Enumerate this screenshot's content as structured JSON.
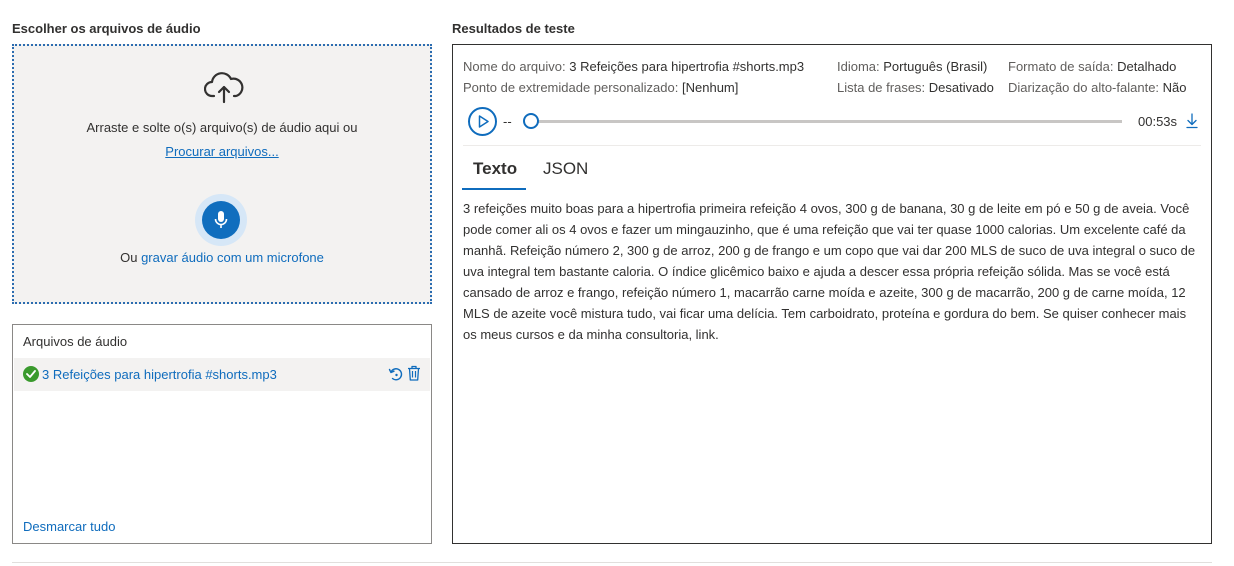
{
  "left": {
    "choose_title": "Escolher os arquivos de áudio",
    "drop_text": "Arraste e solte o(s) arquivo(s) de áudio aqui ou",
    "browse_link": "Procurar arquivos...",
    "record_prefix": "Ou",
    "record_link": "gravar áudio com um microfone",
    "files_title": "Arquivos de áudio",
    "files": [
      {
        "name": "3 Refeições para hipertrofia #shorts.mp3",
        "status": "success"
      }
    ],
    "unselect_all": "Desmarcar tudo"
  },
  "results": {
    "title": "Resultados de teste",
    "file_name_label": "Nome do arquivo:",
    "file_name_value": "3 Refeições para hipertrofia #shorts.mp3",
    "language_label": "Idioma:",
    "language_value": "Português (Brasil)",
    "output_format_label": "Formato de saída:",
    "output_format_value": "Detalhado",
    "endpoint_label": "Ponto de extremidade personalizado:",
    "endpoint_value": "[Nenhum]",
    "phrase_list_label": "Lista de frases:",
    "phrase_list_value": "Desativado",
    "diarization_label": "Diarização do alto-falante:",
    "diarization_value": "Não",
    "player": {
      "current_time": "--",
      "duration": "00:53s",
      "progress": 0
    },
    "tabs": [
      {
        "label": "Texto",
        "active": true
      },
      {
        "label": "JSON",
        "active": false
      }
    ],
    "transcript": "3 refeições muito boas para a hipertrofia primeira refeição 4 ovos, 300 g de banana, 30 g de leite em pó e 50 g de aveia. Você pode comer ali os 4 ovos e fazer um mingauzinho, que é uma refeição que vai ter quase 1000 calorias. Um excelente café da manhã. Refeição número 2, 300 g de arroz, 200 g de frango e um copo que vai dar 200 MLS de suco de uva integral o suco de uva integral tem bastante caloria. O índice glicêmico baixo e ajuda a descer essa própria refeição sólida. Mas se você está cansado de arroz e frango, refeição número 1, macarrão carne moída e azeite, 300 g de macarrão, 200 g de carne moída, 12 MLS de azeite você mistura tudo, vai ficar uma delícia. Tem carboidrato, proteína e gordura do bem. Se quiser conhecer mais os meus cursos e da minha consultoria, link."
  },
  "colors": {
    "accent": "#0f6cbd",
    "success": "#3a9a2d",
    "dropzone_bg": "#f3f2f1"
  },
  "icons": [
    "cloud-upload-icon",
    "microphone-icon",
    "check-circle-icon",
    "reload-icon",
    "trash-icon",
    "play-icon",
    "download-icon"
  ]
}
